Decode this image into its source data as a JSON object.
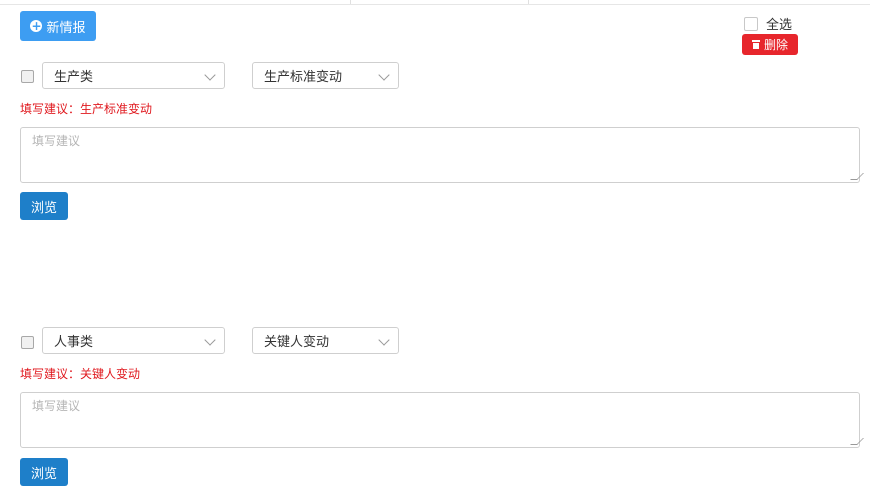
{
  "toolbar": {
    "new_label": "新情报",
    "select_all_label": "全选",
    "delete_label": "删除"
  },
  "entries": [
    {
      "category": "生产类",
      "subcategory": "生产标准变动",
      "suggestion": "填写建议：生产标准变动",
      "textarea_placeholder": "填写建议",
      "browse_label": "浏览"
    },
    {
      "category": "人事类",
      "subcategory": "关键人变动",
      "suggestion": "填写建议：关键人变动",
      "textarea_placeholder": "填写建议",
      "browse_label": "浏览"
    }
  ],
  "colors": {
    "primary": "#3d9df2",
    "browse": "#1e7fc9",
    "danger": "#e7262c",
    "suggest_text": "#e0191f"
  }
}
